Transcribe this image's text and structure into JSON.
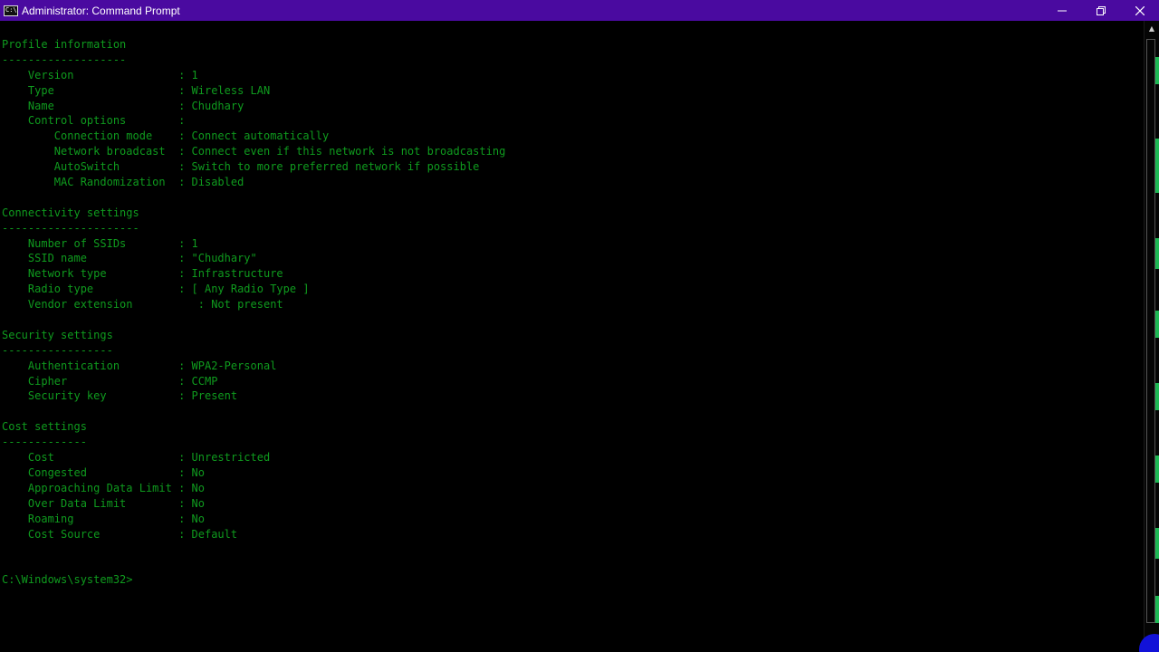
{
  "window": {
    "title": "Administrator: Command Prompt",
    "app_icon_glyph": "C:\\",
    "minimize_glyph": "—",
    "restore_glyph": "❐",
    "close_glyph": "✕"
  },
  "colors": {
    "titlebar": "#4a0aa0",
    "console_text": "#0f9b1e",
    "background": "#000000"
  },
  "console": {
    "lines": [
      "Profile information",
      "-------------------",
      "    Version                : 1",
      "    Type                   : Wireless LAN",
      "    Name                   : Chudhary",
      "    Control options        :",
      "        Connection mode    : Connect automatically",
      "        Network broadcast  : Connect even if this network is not broadcasting",
      "        AutoSwitch         : Switch to more preferred network if possible",
      "        MAC Randomization  : Disabled",
      "",
      "Connectivity settings",
      "---------------------",
      "    Number of SSIDs        : 1",
      "    SSID name              : \"Chudhary\"",
      "    Network type           : Infrastructure",
      "    Radio type             : [ Any Radio Type ]",
      "    Vendor extension          : Not present",
      "",
      "Security settings",
      "-----------------",
      "    Authentication         : WPA2-Personal",
      "    Cipher                 : CCMP",
      "    Security key           : Present",
      "",
      "Cost settings",
      "-------------",
      "    Cost                   : Unrestricted",
      "    Congested              : No",
      "    Approaching Data Limit : No",
      "    Over Data Limit        : No",
      "    Roaming                : No",
      "    Cost Source            : Default",
      "",
      "",
      "C:\\Windows\\system32>"
    ]
  },
  "scrollbar": {
    "up_glyph": "▲",
    "down_glyph": "▼"
  }
}
